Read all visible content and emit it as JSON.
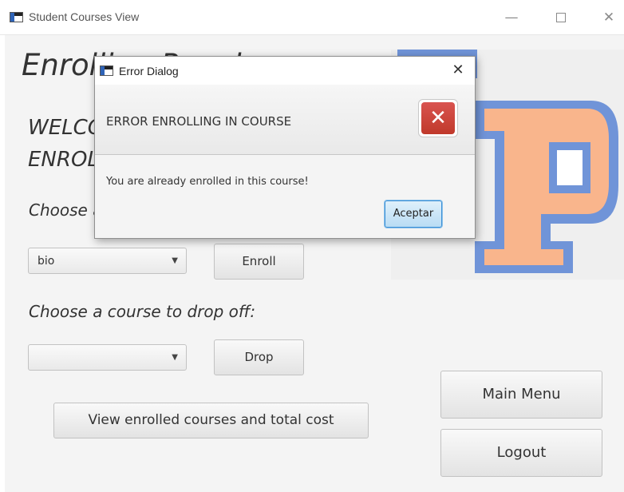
{
  "window": {
    "title": "Student Courses View",
    "minimize_glyph": "—",
    "close_glyph": "✕"
  },
  "main": {
    "heading": "Enrolling Panel",
    "welcome_line1": "WELCOME TO THE",
    "welcome_line2": "ENROLLING PANEL",
    "choose_enroll_label": "Choose a course to enroll in:",
    "enroll_combo_value": "bio",
    "combo_arrow_glyph": "▼",
    "enroll_button": "Enroll",
    "choose_drop_label": "Choose a course to drop off:",
    "drop_combo_value": "",
    "drop_button": "Drop",
    "view_button": "View enrolled courses and total cost",
    "main_menu_button": "Main Menu",
    "logout_button": "Logout",
    "logo_letter": "P",
    "logo_colors": {
      "fill": "#f9b58c",
      "outline": "#7094d8",
      "inner": "#ffffff"
    }
  },
  "dialog": {
    "title": "Error Dialog",
    "close_glyph": "✕",
    "header_text": "ERROR ENROLLING IN COURSE",
    "error_icon_glyph": "✕",
    "message": "You are already enrolled in this course!",
    "ok_button": "Aceptar",
    "accent": "#d9534f"
  }
}
